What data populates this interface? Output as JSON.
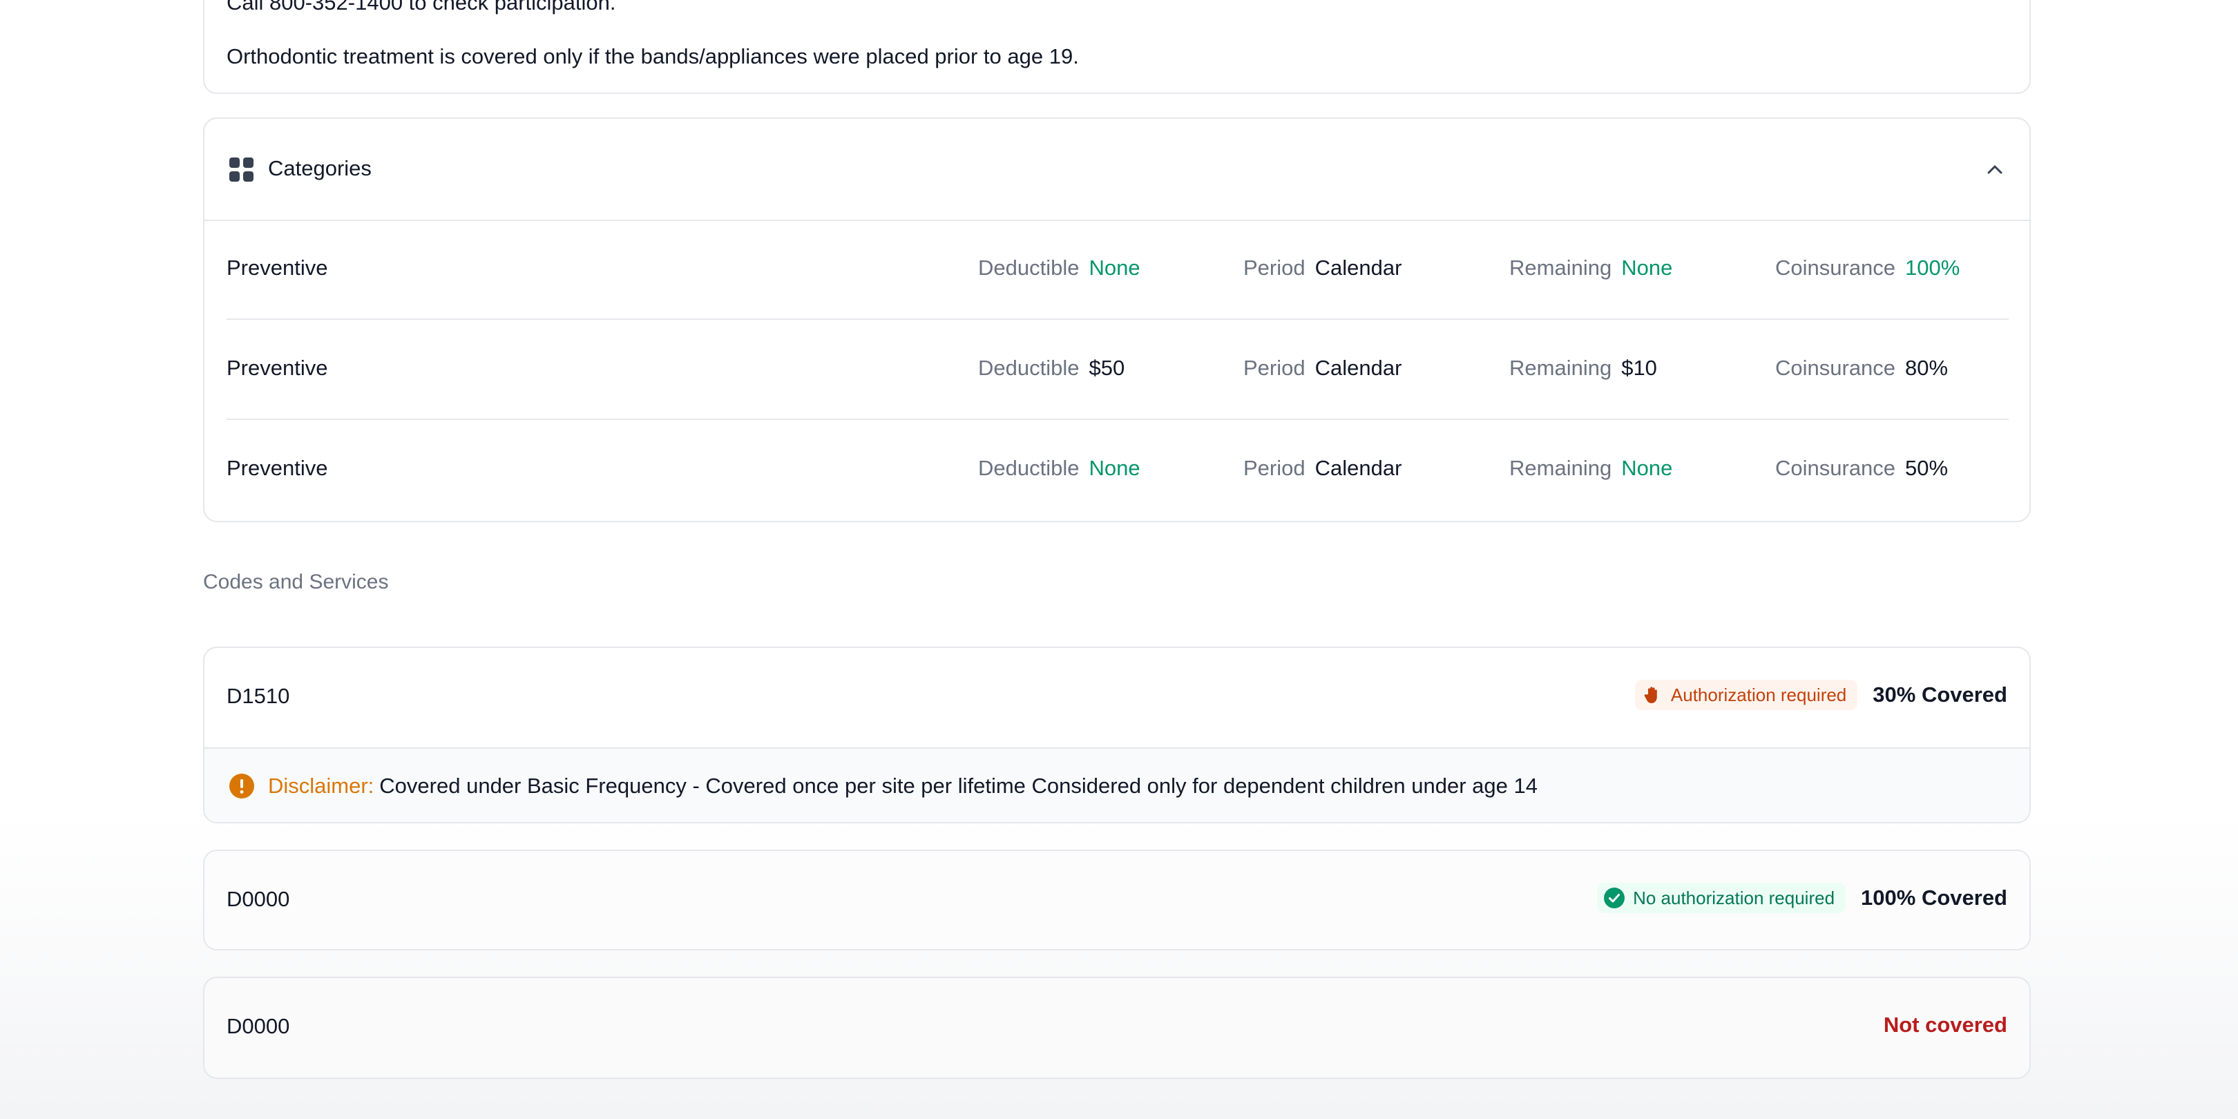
{
  "notes": {
    "line1": "Call 800-352-1400 to check participation.",
    "line2": "Orthodontic treatment is covered only if the bands/appliances were placed prior to age 19."
  },
  "categories": {
    "title": "Categories",
    "labels": {
      "deductible": "Deductible",
      "period": "Period",
      "remaining": "Remaining",
      "coinsurance": "Coinsurance"
    },
    "rows": [
      {
        "name": "Preventive",
        "deductible": "None",
        "period": "Calendar",
        "remaining": "None",
        "coinsurance": "100%"
      },
      {
        "name": "Preventive",
        "deductible": "$50",
        "period": "Calendar",
        "remaining": "$10",
        "coinsurance": "80%"
      },
      {
        "name": "Preventive",
        "deductible": "None",
        "period": "Calendar",
        "remaining": "None",
        "coinsurance": "50%"
      }
    ]
  },
  "codes_section": {
    "label": "Codes and Services",
    "items": [
      {
        "code": "D1510",
        "badge": "Authorization required",
        "badge_icon": "hand-stop-icon",
        "coverage": "30% Covered",
        "disclaimer_label": "Disclaimer:",
        "disclaimer_text": "Covered under Basic Frequency - Covered once per site per lifetime Considered only for dependent children under age 14"
      },
      {
        "code": "D0000",
        "badge": "No authorization required",
        "badge_icon": "check-circle-icon",
        "coverage": "100% Covered"
      },
      {
        "code": "D0000",
        "coverage": "Not covered"
      }
    ]
  },
  "colors": {
    "green": "#059669",
    "warning": "#c2410c",
    "amber": "#d97706",
    "red": "#b91c1c",
    "muted": "#6b7280"
  }
}
